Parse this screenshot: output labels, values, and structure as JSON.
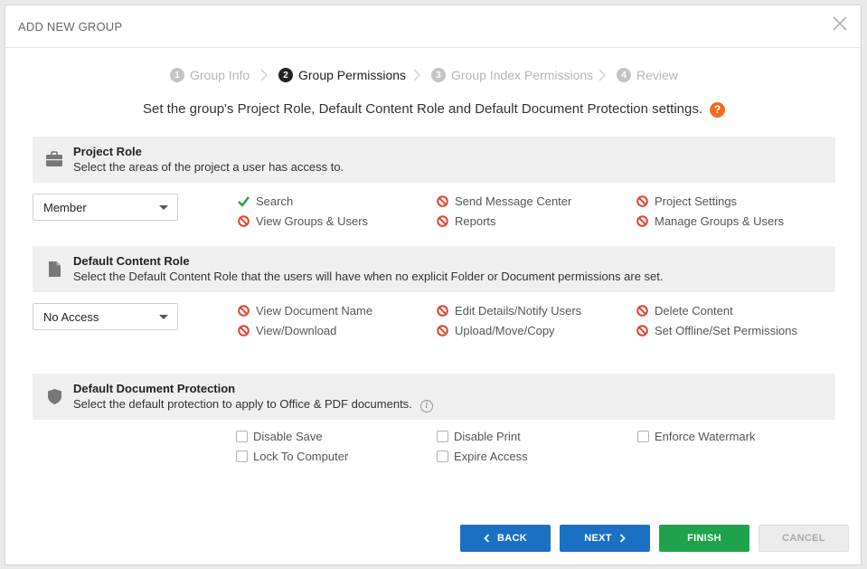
{
  "modal": {
    "title": "ADD NEW GROUP"
  },
  "steps": [
    {
      "number": "1",
      "label": "Group Info",
      "state": "inactive"
    },
    {
      "number": "2",
      "label": "Group Permissions",
      "state": "active"
    },
    {
      "number": "3",
      "label": "Group Index Permissions",
      "state": "inactive"
    },
    {
      "number": "4",
      "label": "Review",
      "state": "inactive"
    }
  ],
  "instruction": {
    "text": "Set the group's Project Role, Default Content Role and Default Document Protection settings.",
    "help_icon": "?"
  },
  "project_role": {
    "title": "Project Role",
    "subtitle": "Select the areas of the project a user has access to.",
    "icon": "briefcase-icon",
    "selected": "Member",
    "permissions": [
      {
        "label": "Search",
        "allowed": true
      },
      {
        "label": "Send Message Center",
        "allowed": false
      },
      {
        "label": "Project Settings",
        "allowed": false
      },
      {
        "label": "View Groups & Users",
        "allowed": false
      },
      {
        "label": "Reports",
        "allowed": false
      },
      {
        "label": "Manage Groups & Users",
        "allowed": false
      }
    ]
  },
  "content_role": {
    "title": "Default Content Role",
    "subtitle": "Select the Default Content Role that the users will have when no explicit Folder or Document permissions are set.",
    "icon": "document-icon",
    "selected": "No Access",
    "permissions": [
      {
        "label": "View Document Name",
        "allowed": false
      },
      {
        "label": "Edit Details/Notify Users",
        "allowed": false
      },
      {
        "label": "Delete Content",
        "allowed": false
      },
      {
        "label": "View/Download",
        "allowed": false
      },
      {
        "label": "Upload/Move/Copy",
        "allowed": false
      },
      {
        "label": "Set Offline/Set Permissions",
        "allowed": false
      }
    ]
  },
  "protection": {
    "title": "Default Document Protection",
    "subtitle": "Select the default protection to apply to Office & PDF documents.",
    "icon": "shield-icon",
    "info_icon": "i",
    "options": [
      {
        "label": "Disable Save",
        "checked": false
      },
      {
        "label": "Disable Print",
        "checked": false
      },
      {
        "label": "Enforce Watermark",
        "checked": false
      },
      {
        "label": "Lock To Computer",
        "checked": false
      },
      {
        "label": "Expire Access",
        "checked": false
      }
    ]
  },
  "buttons": {
    "back": "BACK",
    "next": "NEXT",
    "finish": "FINISH",
    "cancel": "CANCEL"
  },
  "colors": {
    "primary": "#1a70c3",
    "success": "#1ea34c",
    "deny": "#e0462f",
    "allow": "#2a9d3c",
    "help": "#f36b21"
  }
}
